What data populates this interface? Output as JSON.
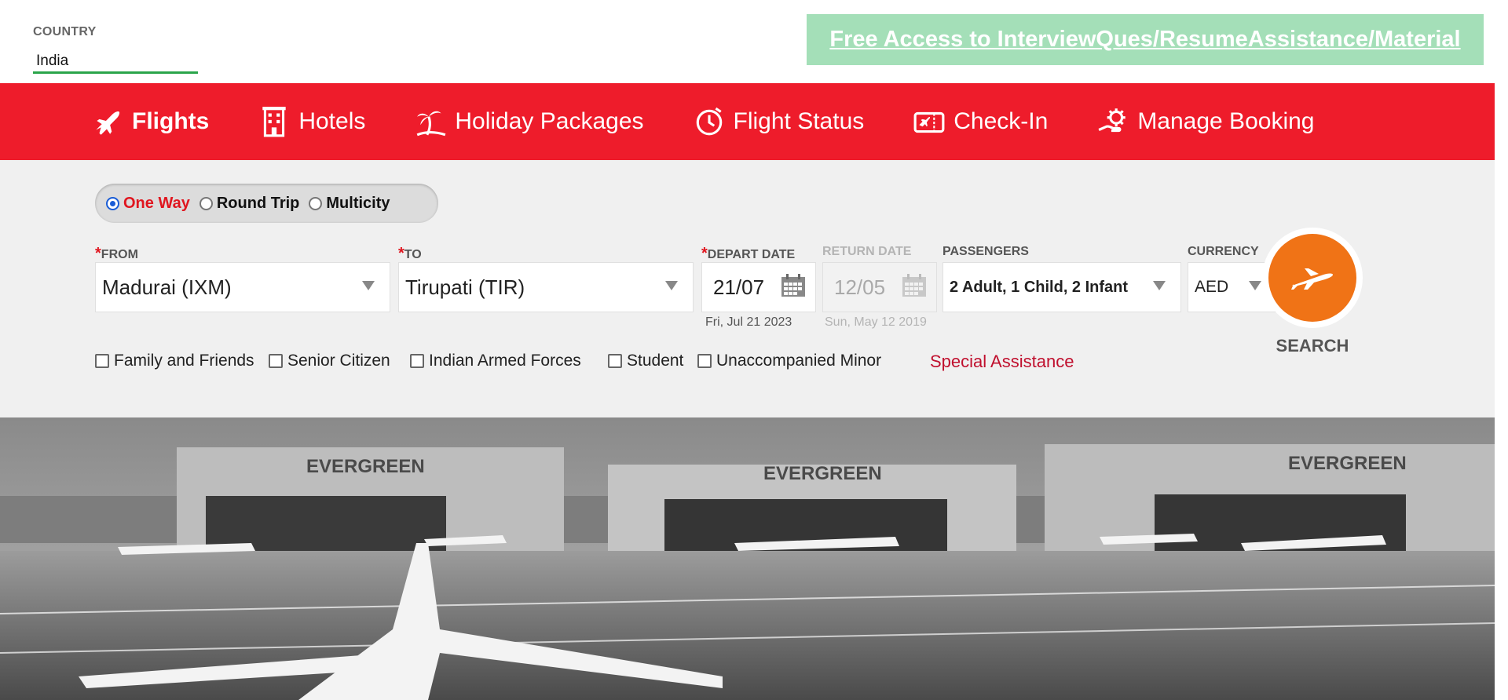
{
  "country": {
    "label": "COUNTRY",
    "value": "India"
  },
  "promo": {
    "text": "Free Access to InterviewQues/ResumeAssistance/Material"
  },
  "nav": {
    "items": [
      {
        "label": "Flights",
        "icon": "plane-icon",
        "active": true
      },
      {
        "label": "Hotels",
        "icon": "hotel-building-icon"
      },
      {
        "label": "Holiday Packages",
        "icon": "palm-tree-icon"
      },
      {
        "label": "Flight Status",
        "icon": "clock-status-icon"
      },
      {
        "label": "Check-In",
        "icon": "boarding-ticket-icon"
      },
      {
        "label": "Manage Booking",
        "icon": "gear-hand-icon"
      }
    ]
  },
  "trip_type": {
    "options": [
      "One Way",
      "Round Trip",
      "Multicity"
    ],
    "selected": "One Way"
  },
  "form": {
    "from": {
      "label": "FROM",
      "value": "Madurai (IXM)"
    },
    "to": {
      "label": "TO",
      "value": "Tirupati (TIR)"
    },
    "depart": {
      "label": "DEPART DATE",
      "value": "21/07",
      "full": "Fri, Jul 21 2023"
    },
    "return": {
      "label": "RETURN DATE",
      "value": "12/05",
      "full": "Sun, May 12 2019"
    },
    "passengers": {
      "label": "PASSENGERS",
      "value": "2 Adult, 1 Child, 2 Infant"
    },
    "currency": {
      "label": "CURRENCY",
      "value": "AED"
    },
    "required_marker": "*"
  },
  "search": {
    "label": "SEARCH"
  },
  "concessions": [
    "Family and Friends",
    "Senior Citizen",
    "Indian Armed Forces",
    "Student",
    "Unaccompanied Minor"
  ],
  "special_assistance": "Special Assistance",
  "hero": {
    "signage": [
      "EVERGREEN",
      "EVERGREEN",
      "EVERGREEN"
    ]
  },
  "colors": {
    "brand_red": "#ee1c2b",
    "search_orange": "#f07316",
    "promo_green": "#a4dfb8",
    "selected_radio": "#1a5dd6"
  }
}
